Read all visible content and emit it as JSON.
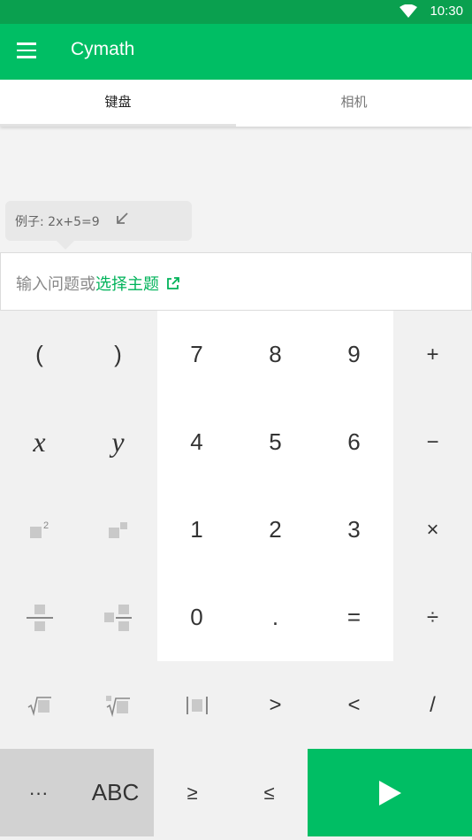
{
  "status_bar": {
    "time": "10:30",
    "icons": [
      "wifi-icon"
    ]
  },
  "app_bar": {
    "title": "Cymath",
    "menu_icon": "menu-icon",
    "color": "#00be64"
  },
  "tabs": [
    {
      "label": "键盘",
      "active": true
    },
    {
      "label": "相机",
      "active": false
    }
  ],
  "example_tip": {
    "text": "例子: 2x+5=9",
    "icon": "arrow-down-left-icon"
  },
  "input": {
    "placeholder": "输入问题或",
    "topic_link": "选择主题",
    "link_icon": "external-link-icon",
    "link_color": "#00b35a"
  },
  "keypad": {
    "left_keys": [
      {
        "label": "(",
        "name": "open-paren-key"
      },
      {
        "label": ")",
        "name": "close-paren-key"
      },
      {
        "label": "x",
        "name": "x-key"
      },
      {
        "label": "y",
        "name": "y-key"
      }
    ],
    "icon_keys": [
      {
        "name": "square-power-key",
        "icon": "exponent-square-icon"
      },
      {
        "name": "custom-power-key",
        "icon": "exponent-box-icon"
      },
      {
        "name": "fraction-key",
        "icon": "fraction-icon"
      },
      {
        "name": "mixed-fraction-key",
        "icon": "mixed-fraction-icon"
      },
      {
        "name": "sqrt-key",
        "icon": "sqrt-icon"
      },
      {
        "name": "nth-root-key",
        "icon": "nth-root-icon"
      },
      {
        "name": "abs-key",
        "icon": "absolute-value-icon"
      }
    ],
    "digits": [
      "7",
      "8",
      "9",
      "4",
      "5",
      "6",
      "1",
      "2",
      "3",
      "0",
      ".",
      "="
    ],
    "operators": [
      "+",
      "−",
      "×",
      "÷",
      "/"
    ],
    "comparators": [
      ">",
      "<"
    ],
    "bottom": {
      "more": "···",
      "abc": "ABC",
      "gte": "≥",
      "lte": "≤",
      "submit_icon": "play-icon"
    }
  }
}
